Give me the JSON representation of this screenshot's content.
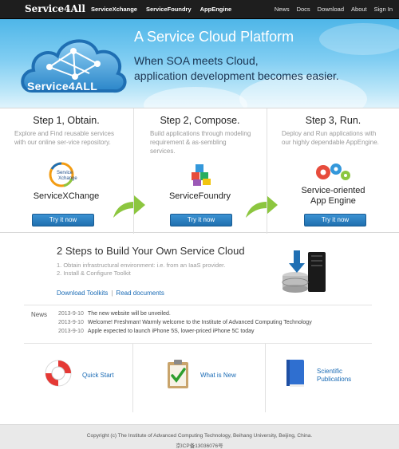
{
  "topbar": {
    "brand": "Service4All",
    "left_links": [
      "ServiceXchange",
      "ServiceFoundry",
      "AppEngine"
    ],
    "right_links": [
      "News",
      "Docs",
      "Download",
      "About",
      "Sign In"
    ]
  },
  "hero": {
    "title": "A Service Cloud Platform",
    "subtitle_line1": "When SOA meets Cloud,",
    "subtitle_line2": "application development becomes easier.",
    "logo_text": "Service4ALL",
    "colors": {
      "sky": "#5bbbe9",
      "logo_blue": "#1f6fb3"
    }
  },
  "steps": [
    {
      "title": "Step 1, Obtain.",
      "desc": "Explore and Find reusable services with our online ser-vice repository.",
      "product": "ServiceXChange",
      "logo_label_line1": "Service",
      "logo_label_line2": "Xchange",
      "button": "Try it now",
      "icon": "servicexchange-logo-icon"
    },
    {
      "title": "Step 2, Compose.",
      "desc": "Build applications through modeling requirement & as-sembling services.",
      "product": "ServiceFoundry",
      "button": "Try it now",
      "icon": "cubes-icon"
    },
    {
      "title": "Step 3, Run.",
      "desc": "Deploy and Run applications with our highly dependable AppEngine.",
      "product_line1": "Service-oriented",
      "product_line2": "App Engine",
      "button": "Try it now",
      "icon": "gears-icon"
    }
  ],
  "build": {
    "title": "2 Steps to Build Your Own Service Cloud",
    "items": [
      "1. Obtain infrastructural environment: i.e. from an IaaS provider.",
      "2. Install & Configure Toolkit"
    ],
    "link_download": "Download Toolkits",
    "separator": "|",
    "link_docs": "Read documents"
  },
  "news": {
    "label": "News",
    "items": [
      {
        "date": "2013-9-10",
        "text": "The new website will be unveiled."
      },
      {
        "date": "2013-9-10",
        "text": "Welcome! Freshman! Warmly welcome to the Institute of Advanced Computing Technology"
      },
      {
        "date": "2013-9-10",
        "text": "Apple expected to launch iPhone 5S, lower-priced iPhone 5C today"
      }
    ]
  },
  "features": [
    {
      "label": "Quick Start",
      "icon": "lifebuoy-icon"
    },
    {
      "label": "What is New",
      "icon": "clipboard-check-icon"
    },
    {
      "label_line1": "Scientific",
      "label_line2": "Publications",
      "icon": "book-icon"
    }
  ],
  "footer": {
    "line1": "Copyright (c) The Institute of Advanced Computing Technology, Beihang University, Beijing, China.",
    "line2": "京ICP备13036076号"
  },
  "colors": {
    "button_blue": "#2a7fc3",
    "arrow_green": "#8cc63f",
    "link_blue": "#1a6bb5",
    "topbar": "#1e1e1e"
  }
}
